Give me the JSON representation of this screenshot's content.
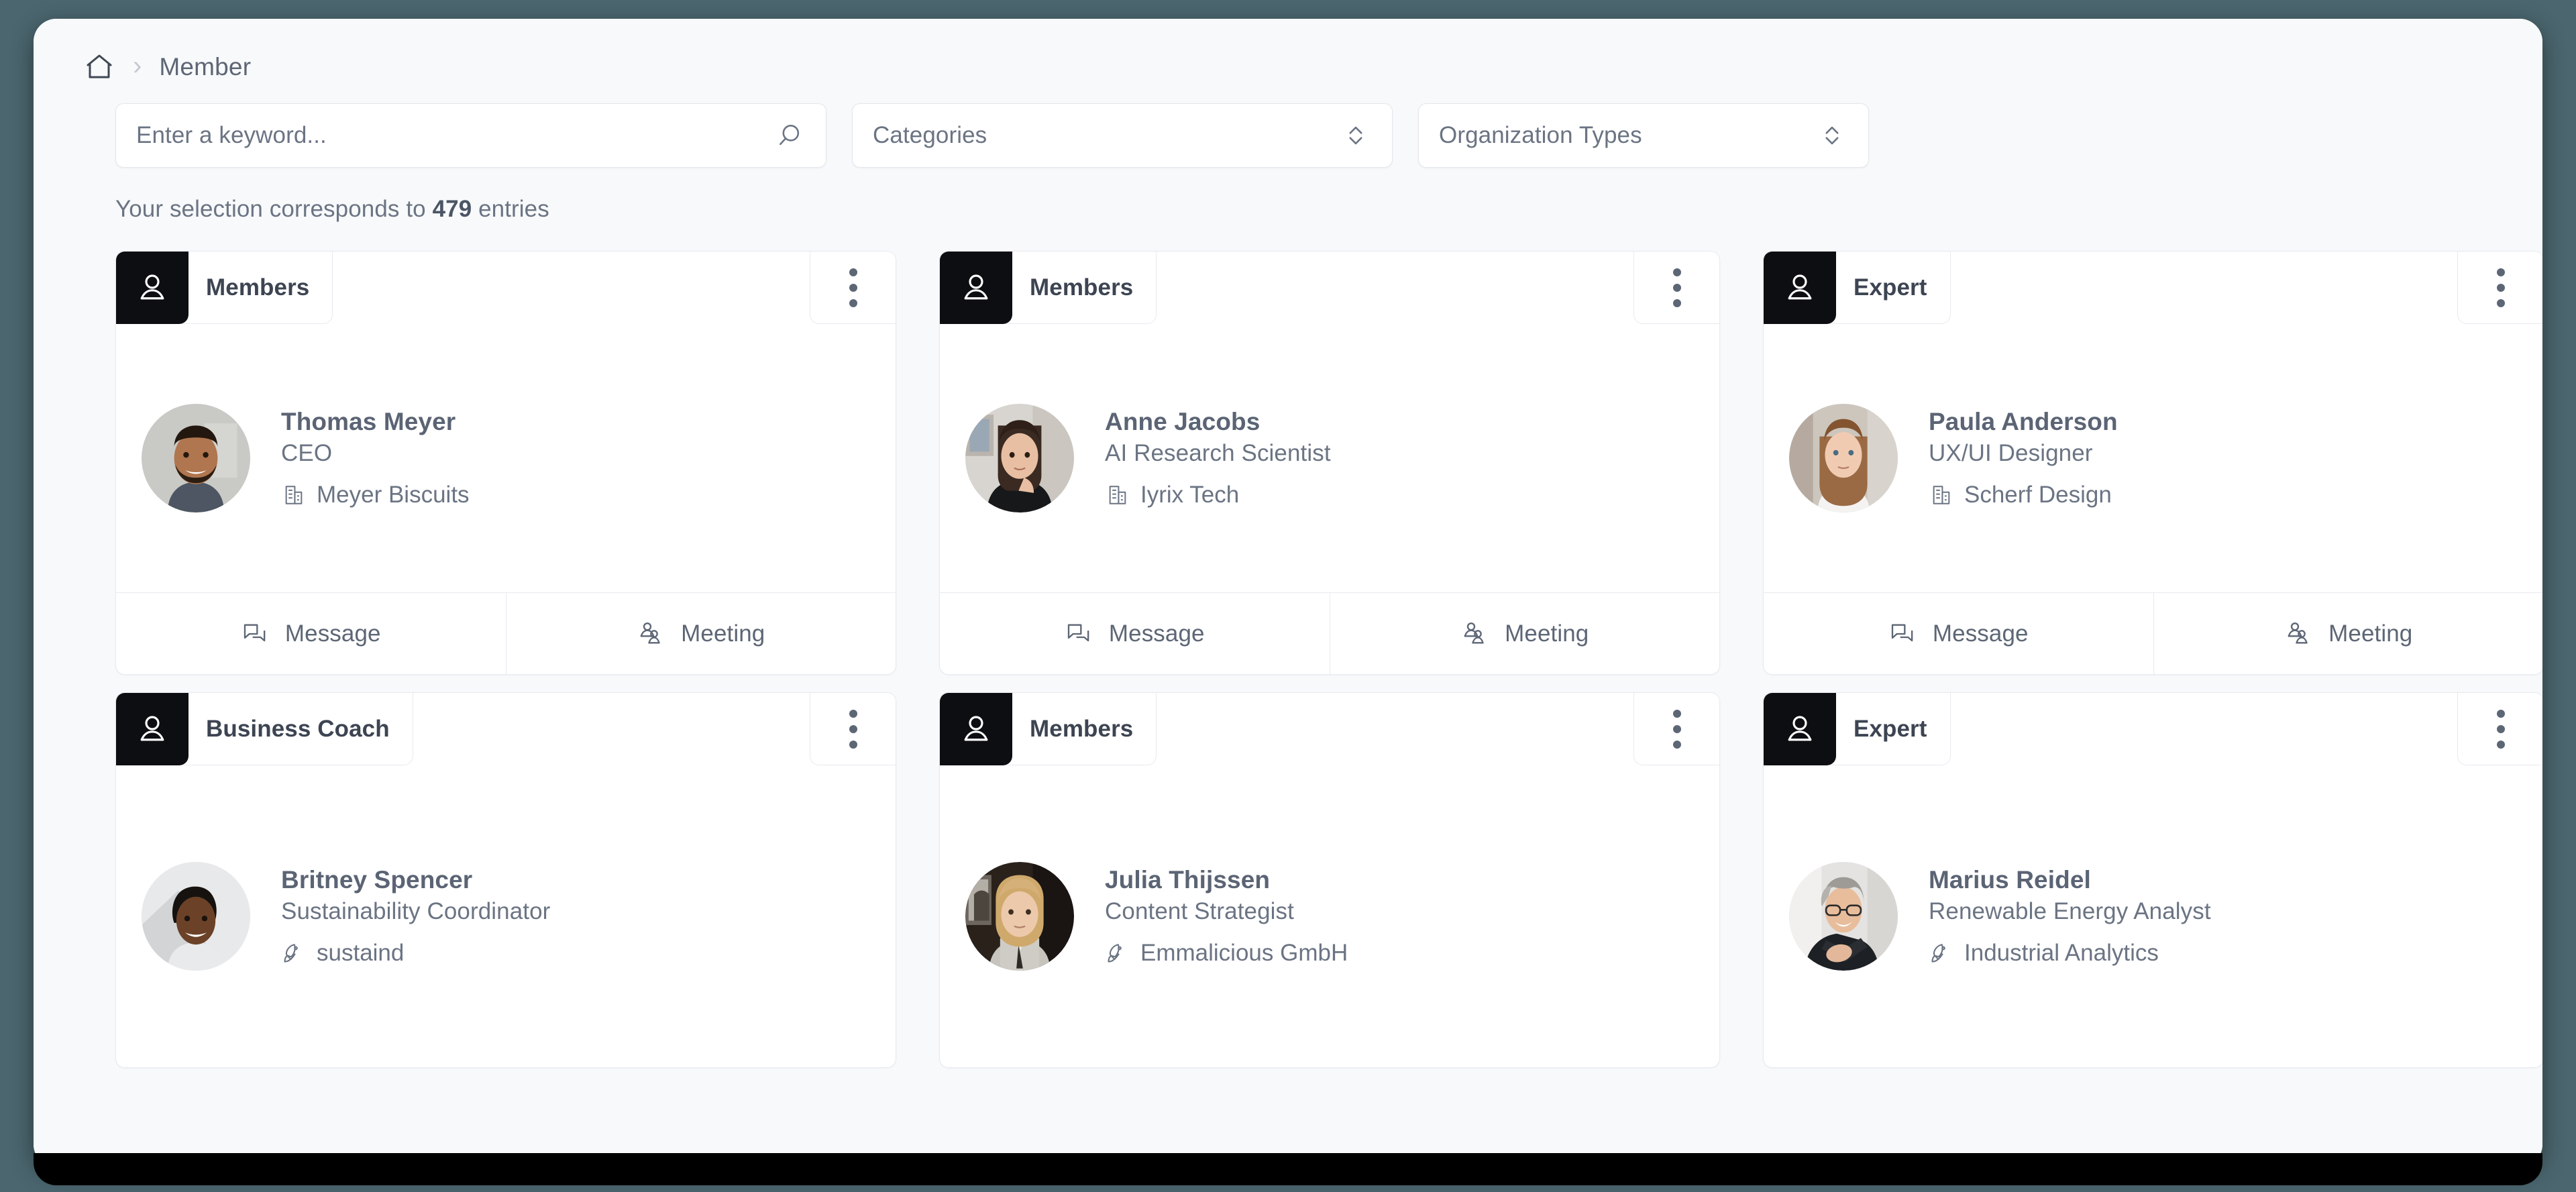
{
  "window": {
    "background_color": "#4b666f",
    "page_background": "#f7f9fb",
    "accent_dark": "#0d0e11",
    "text_color": "#5d6675"
  },
  "breadcrumb": {
    "home_icon": "home-icon",
    "separator": "›",
    "current": "Member"
  },
  "filters": {
    "search": {
      "placeholder": "Enter a keyword...",
      "value": "",
      "icon": "search-icon"
    },
    "categories": {
      "label": "Categories",
      "icon": "chevron-up-down-icon"
    },
    "organization_types": {
      "label": "Organization Types",
      "icon": "chevron-up-down-icon"
    }
  },
  "results": {
    "prefix": "Your selection corresponds to",
    "count": "479",
    "suffix": "entries"
  },
  "card_actions": {
    "message": "Message",
    "meeting": "Meeting",
    "message_icon": "chat-bubble-icon",
    "meeting_icon": "people-icon",
    "menu_icon": "kebab-menu-icon",
    "badge_icon": "person-icon"
  },
  "cards": [
    {
      "badge": "Members",
      "name": "Thomas Meyer",
      "role": "CEO",
      "org": "Meyer Biscuits",
      "org_icon": "building-icon",
      "avatar": "man-bearded-smiling",
      "has_footer": true
    },
    {
      "badge": "Members",
      "name": "Anne Jacobs",
      "role": "AI Research Scientist",
      "org": "Iyrix Tech",
      "org_icon": "building-icon",
      "avatar": "woman-dark-hair-black-top",
      "has_footer": true
    },
    {
      "badge": "Expert",
      "name": "Paula Anderson",
      "role": "UX/UI Designer",
      "org": "Scherf Design",
      "org_icon": "building-icon",
      "avatar": "woman-auburn-hair-white-top",
      "has_footer": true
    },
    {
      "badge": "Business Coach",
      "name": "Britney Spencer",
      "role": "Sustainability Coordinator",
      "org": "sustaind",
      "org_icon": "rocket-icon",
      "avatar": "woman-short-hair-smiling",
      "has_footer": false
    },
    {
      "badge": "Members",
      "name": "Julia Thijssen",
      "role": "Content Strategist",
      "org": "Emmalicious GmbH",
      "org_icon": "rocket-icon",
      "avatar": "woman-blonde-suit",
      "has_footer": false
    },
    {
      "badge": "Expert",
      "name": "Marius Reidel",
      "role": "Renewable Energy Analyst",
      "org": "Industrial Analytics",
      "org_icon": "rocket-icon",
      "avatar": "man-glasses-grey-hair",
      "has_footer": false
    }
  ]
}
